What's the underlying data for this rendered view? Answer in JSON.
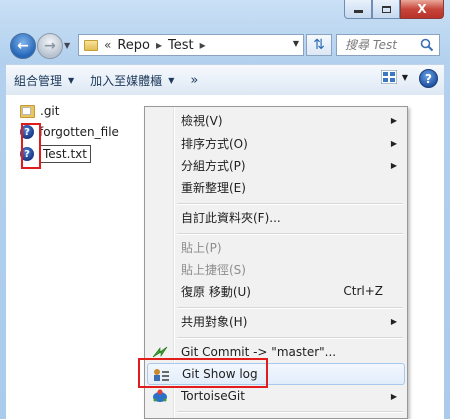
{
  "window": {
    "close_label": "X"
  },
  "address": {
    "overflow": "«",
    "crumbs": [
      "Repo",
      "Test"
    ],
    "separator": "▸"
  },
  "search": {
    "placeholder": "搜尋 Test"
  },
  "toolbar": {
    "organize": "組合管理",
    "add_to_library": "加入至媒體櫃",
    "more": "»",
    "help": "?"
  },
  "files": [
    {
      "name": ".git",
      "icon": "folder-icon"
    },
    {
      "name": "forgotten_file",
      "icon": "question-overlay-icon"
    },
    {
      "name": "Test.txt",
      "icon": "question-overlay-icon"
    }
  ],
  "menu": {
    "items": [
      {
        "label": "檢視(V)",
        "submenu": true
      },
      {
        "label": "排序方式(O)",
        "submenu": true
      },
      {
        "label": "分組方式(P)",
        "submenu": true
      },
      {
        "label": "重新整理(E)"
      },
      {
        "label": "自訂此資料夾(F)..."
      },
      {
        "label": "貼上(P)",
        "disabled": true
      },
      {
        "label": "貼上捷徑(S)",
        "disabled": true
      },
      {
        "label": "復原 移動(U)",
        "shortcut": "Ctrl+Z"
      },
      {
        "label": "共用對象(H)",
        "submenu": true
      },
      {
        "label": "Git Commit -> \"master\"...",
        "icon": "git-commit-icon"
      },
      {
        "label": "Git Show log",
        "icon": "git-log-icon",
        "highlighted": true
      },
      {
        "label": "TortoiseGit",
        "icon": "tortoisegit-icon",
        "submenu": true
      }
    ]
  },
  "colors": {
    "highlight_box": "#e01c1c",
    "accent": "#1d4f9f"
  }
}
